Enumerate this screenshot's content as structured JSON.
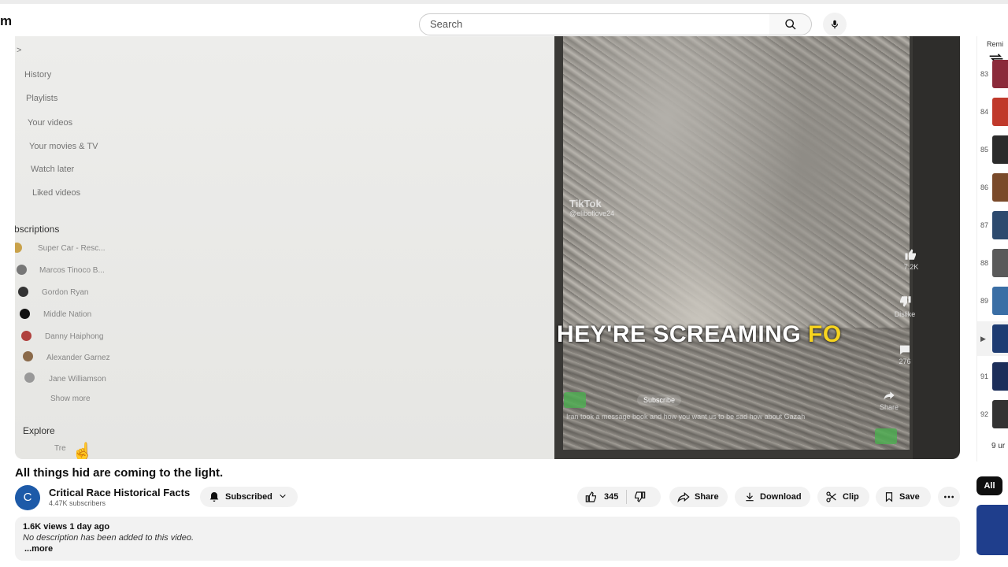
{
  "header": {
    "logo_fragment": "m",
    "search_placeholder": "Search"
  },
  "icons": {
    "search": "search-icon",
    "mic": "mic-icon"
  },
  "player": {
    "sidebar": {
      "chevron": ">",
      "items": [
        "History",
        "Playlists",
        "Your videos",
        "Your movies & TV",
        "Watch later",
        "Liked videos"
      ],
      "subscriptions_heading": "bscriptions",
      "channels": [
        "Super Car - Resc...",
        "Marcos Tinoco B...",
        "Gordon Ryan",
        "Middle Nation",
        "Danny Haiphong",
        "Alexander Garnez",
        "Jane Williamson"
      ],
      "show_more": "Show more",
      "explore_heading": "Explore",
      "trending_fragment": "Tre"
    },
    "tiktok": {
      "logo": "TikTok",
      "handle": "@eliboflove24",
      "caption_main": "HEY'RE SCREAMING ",
      "caption_highlight": "FO",
      "likes": "7.2K",
      "dislike": "Dislike",
      "comments": "276",
      "share": "Share",
      "subscribe": "Subscribe",
      "bottom_text": "Iran took a message book and how you want us to be sad how about Gazah"
    }
  },
  "video": {
    "title": "All things hid are coming to the light.",
    "channel": {
      "avatar_letter": "C",
      "name": "Critical Race Historical Facts",
      "subscribers": "4.47K subscribers"
    },
    "subscribed_label": "Subscribed",
    "actions": {
      "likes": "345",
      "share": "Share",
      "download": "Download",
      "clip": "Clip",
      "save": "Save"
    },
    "description": {
      "views_date": "1.6K views  1 day ago",
      "text": "No description has been added to this video.",
      "more": "...more"
    }
  },
  "right_panel": {
    "heading": "Remi",
    "rows": [
      {
        "num": "83",
        "color": "#8b2a3a"
      },
      {
        "num": "84",
        "color": "#c0392b"
      },
      {
        "num": "85",
        "color": "#2b2b2b"
      },
      {
        "num": "86",
        "color": "#7a4a2a"
      },
      {
        "num": "87",
        "color": "#2d4a6e"
      },
      {
        "num": "88",
        "color": "#5a5a5a"
      },
      {
        "num": "89",
        "color": "#3a6ea5"
      },
      {
        "num": "▶",
        "color": "#1e3c72"
      },
      {
        "num": "91",
        "color": "#1c2e5a"
      },
      {
        "num": "92",
        "color": "#333333"
      }
    ],
    "footer": "9 ur",
    "chip_all": "All"
  }
}
